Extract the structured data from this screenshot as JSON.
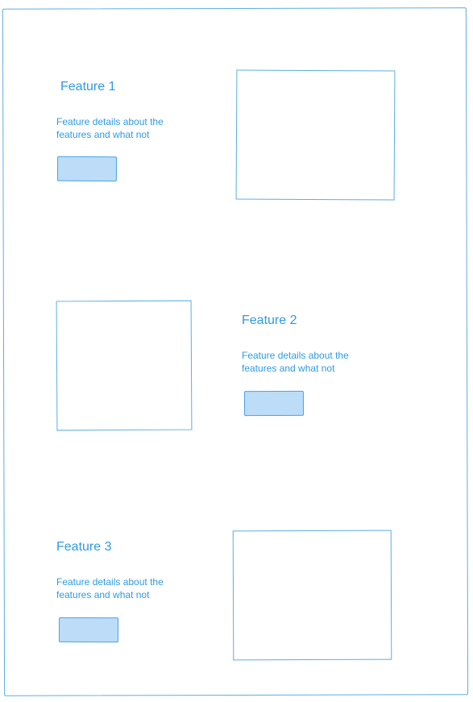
{
  "features": [
    {
      "title": "Feature 1",
      "description": "Feature details about the features and what not"
    },
    {
      "title": "Feature 2",
      "description": "Feature details about the features and what not"
    },
    {
      "title": "Feature 3",
      "description": "Feature details about the features and what not"
    }
  ],
  "colors": {
    "sketch_line": "#5aaee6",
    "text": "#2e9ae4",
    "button_fill": "#bcdcf8",
    "background": "#ffffff"
  }
}
